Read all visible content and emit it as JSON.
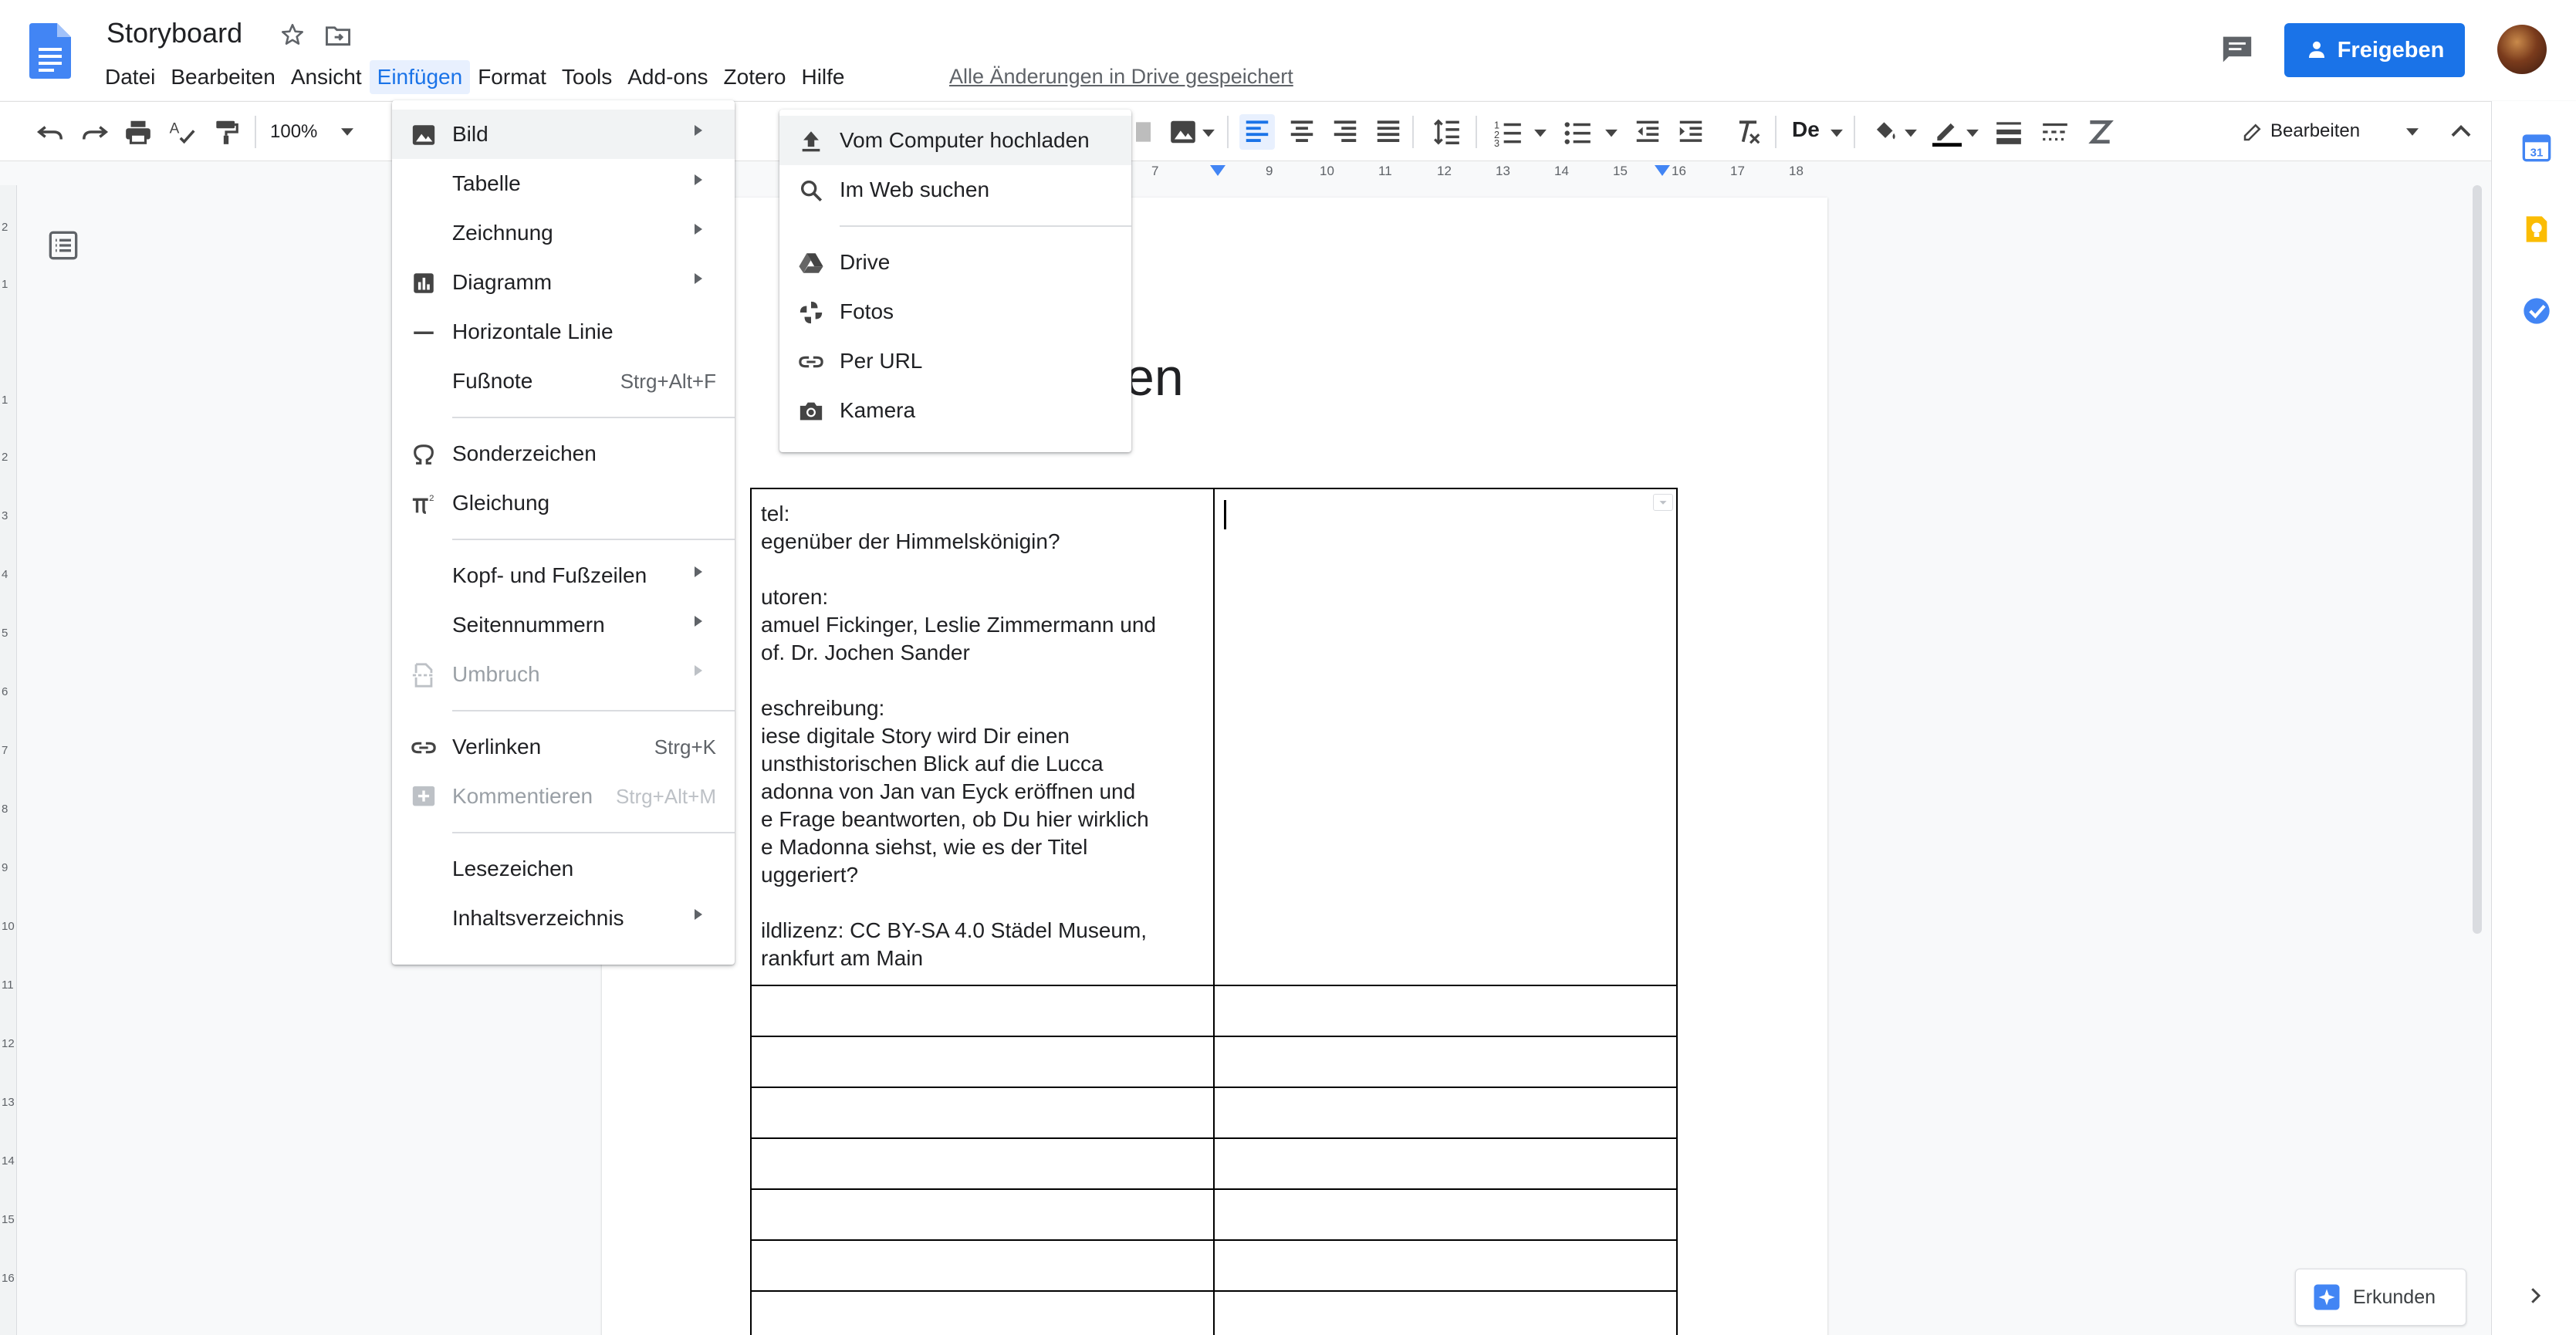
{
  "document": {
    "title": "Storyboard",
    "save_status": "Alle Änderungen in Drive gespeichert"
  },
  "menubar": [
    "Datei",
    "Bearbeiten",
    "Ansicht",
    "Einfügen",
    "Format",
    "Tools",
    "Add-ons",
    "Zotero",
    "Hilfe"
  ],
  "share_button": "Freigeben",
  "toolbar": {
    "zoom": "100%",
    "style_preview": "De",
    "edit_mode": "Bearbeiten"
  },
  "ruler_labels": [
    "7",
    "9",
    "10",
    "11",
    "12",
    "13",
    "14",
    "15",
    "16",
    "17",
    "18"
  ],
  "vertical_ruler_labels": [
    "2",
    "1",
    "1",
    "2",
    "3",
    "4",
    "5",
    "6",
    "7",
    "8",
    "9",
    "10",
    "11",
    "12",
    "13",
    "14",
    "15",
    "16"
  ],
  "insert_menu": {
    "items": [
      {
        "label": "Bild",
        "icon": "image-icon",
        "arrow": true,
        "highlighted": true
      },
      {
        "label": "Tabelle",
        "arrow": true
      },
      {
        "label": "Zeichnung",
        "arrow": true
      },
      {
        "label": "Diagramm",
        "icon": "chart-icon",
        "arrow": true
      },
      {
        "label": "Horizontale Linie",
        "icon": "horizontal-line-icon"
      },
      {
        "label": "Fußnote",
        "shortcut": "Strg+Alt+F"
      },
      {
        "label": "Sonderzeichen",
        "icon": "omega-icon"
      },
      {
        "label": "Gleichung",
        "icon": "pi-icon"
      },
      {
        "label": "Kopf- und Fußzeilen",
        "arrow": true
      },
      {
        "label": "Seitennummern",
        "arrow": true
      },
      {
        "label": "Umbruch",
        "icon": "page-break-icon",
        "arrow": true,
        "disabled": true
      },
      {
        "label": "Verlinken",
        "icon": "link-icon",
        "shortcut": "Strg+K"
      },
      {
        "label": "Kommentieren",
        "icon": "add-comment-icon",
        "shortcut": "Strg+Alt+M",
        "disabled": true
      },
      {
        "label": "Lesezeichen"
      },
      {
        "label": "Inhaltsverzeichnis",
        "arrow": true
      }
    ]
  },
  "image_submenu": {
    "items": [
      {
        "label": "Vom Computer hochladen",
        "icon": "upload-icon"
      },
      {
        "label": "Im Web suchen",
        "icon": "search-icon"
      },
      {
        "label": "Drive",
        "icon": "drive-icon"
      },
      {
        "label": "Fotos",
        "icon": "photos-icon"
      },
      {
        "label": "Per URL",
        "icon": "link-icon"
      },
      {
        "label": "Kamera",
        "icon": "camera-icon"
      }
    ]
  },
  "page": {
    "heading_fragment": "ellen",
    "table_first_cell": "tel:\negenüber der Himmelskönigin?\n\nutoren:\namuel Fickinger, Leslie Zimmermann und\nof. Dr. Jochen Sander\n\neschreibung:\niese digitale Story wird Dir einen\nunsthistorischen Blick auf die Lucca\nadonna von Jan van Eyck eröffnen und\ne Frage beantworten, ob Du hier wirklich\ne Madonna siehst, wie es der Titel\nuggeriert?\n\nildlizenz: CC BY-SA 4.0 Städel Museum,\nrankfurt am Main"
  },
  "explore_button": "Erkunden",
  "colors": {
    "accent": "#1a73e8",
    "menu_highlight": "#f1f3f4",
    "disabled_text": "#9aa0a6"
  }
}
